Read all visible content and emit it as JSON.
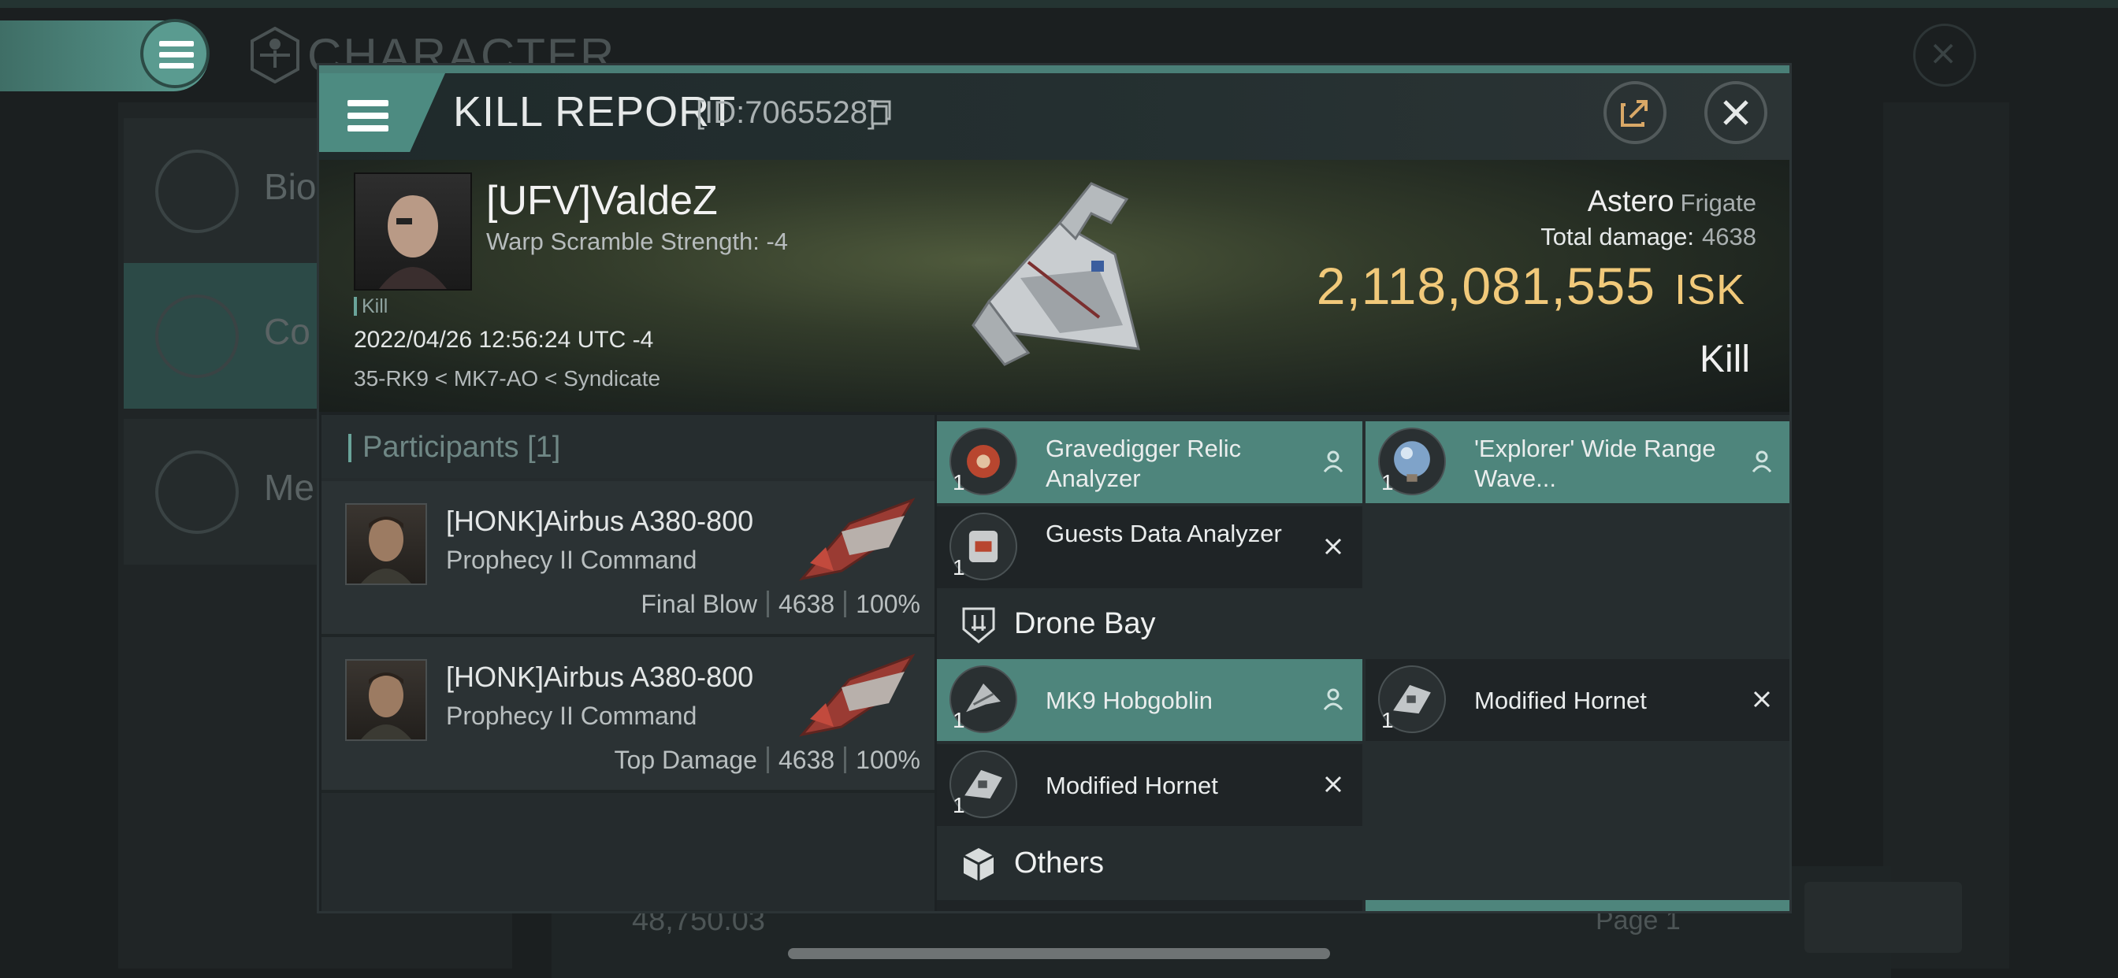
{
  "background": {
    "title": "CHARACTER",
    "sidebar": [
      {
        "label": "Bio"
      },
      {
        "label": "Co"
      },
      {
        "label": "Me"
      }
    ],
    "bottom_value": "48,750.03",
    "page_label": "Page 1"
  },
  "dialog": {
    "title": "KILL REPORT",
    "id_text": "[ID:7065528]"
  },
  "victim": {
    "name": "[UFV]ValdeZ",
    "subtitle": "Warp Scramble Strength: -4",
    "tag": "Kill",
    "datetime": "2022/04/26 12:56:24 UTC -4",
    "location": "35-RK9 < MK7-AO < Syndicate",
    "ship_name": "Astero",
    "ship_class": "Frigate",
    "total_damage_label": "Total damage:",
    "total_damage": "4638",
    "isk_value": "2,118,081,555",
    "isk_unit": "ISK",
    "result": "Kill"
  },
  "participants": {
    "header": "Participants [1]",
    "rows": [
      {
        "name": "[HONK]Airbus A380-800",
        "ship": "Prophecy II Command",
        "role": "Final Blow",
        "damage": "4638",
        "percent": "100%"
      },
      {
        "name": "[HONK]Airbus A380-800",
        "ship": "Prophecy II Command",
        "role": "Top Damage",
        "damage": "4638",
        "percent": "100%"
      }
    ]
  },
  "items": {
    "high": [
      {
        "name": "Gravedigger Relic Analyzer",
        "qty": "1",
        "status": "dropped"
      },
      {
        "name": "'Explorer' Wide Range Wave...",
        "qty": "1",
        "status": "dropped"
      },
      {
        "name": "Guests Data Analyzer",
        "qty": "1",
        "status": "destroyed"
      }
    ],
    "drone_bay": {
      "label": "Drone Bay",
      "entries": [
        {
          "name": "MK9  Hobgoblin",
          "qty": "1",
          "status": "dropped"
        },
        {
          "name": "Modified Hornet",
          "qty": "1",
          "status": "destroyed"
        },
        {
          "name": "Modified Hornet",
          "qty": "1",
          "status": "destroyed"
        }
      ]
    },
    "others": {
      "label": "Others"
    }
  },
  "colors": {
    "accent": "#5a9b90",
    "dropped_highlight": "#4e857c",
    "isk_gold": "#f1c97a"
  }
}
